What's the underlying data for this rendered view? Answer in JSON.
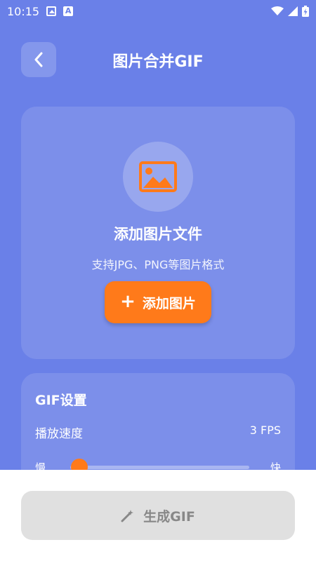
{
  "status_bar": {
    "time": "10:15",
    "icons": [
      "image-notification-icon",
      "a-notification-icon",
      "wifi-icon",
      "signal-icon",
      "battery-charging-icon"
    ]
  },
  "header": {
    "title": "图片合并GIF",
    "back_icon": "chevron-left-icon"
  },
  "upload": {
    "icon": "image-icon",
    "title": "添加图片文件",
    "subtitle": "支持JPG、PNG等图片格式",
    "button_label": "添加图片",
    "button_icon": "plus-icon"
  },
  "settings": {
    "title": "GIF设置",
    "speed_label": "播放速度",
    "speed_value": "3 FPS",
    "slider_min_label": "慢",
    "slider_max_label": "快",
    "slider_level": 0.05
  },
  "generate": {
    "label": "生成GIF",
    "icon": "magic-wand-icon",
    "enabled": false
  },
  "colors": {
    "background": "#6a80e8",
    "accent": "#ff7a1a",
    "disabled_button": "#e0e0e0"
  }
}
